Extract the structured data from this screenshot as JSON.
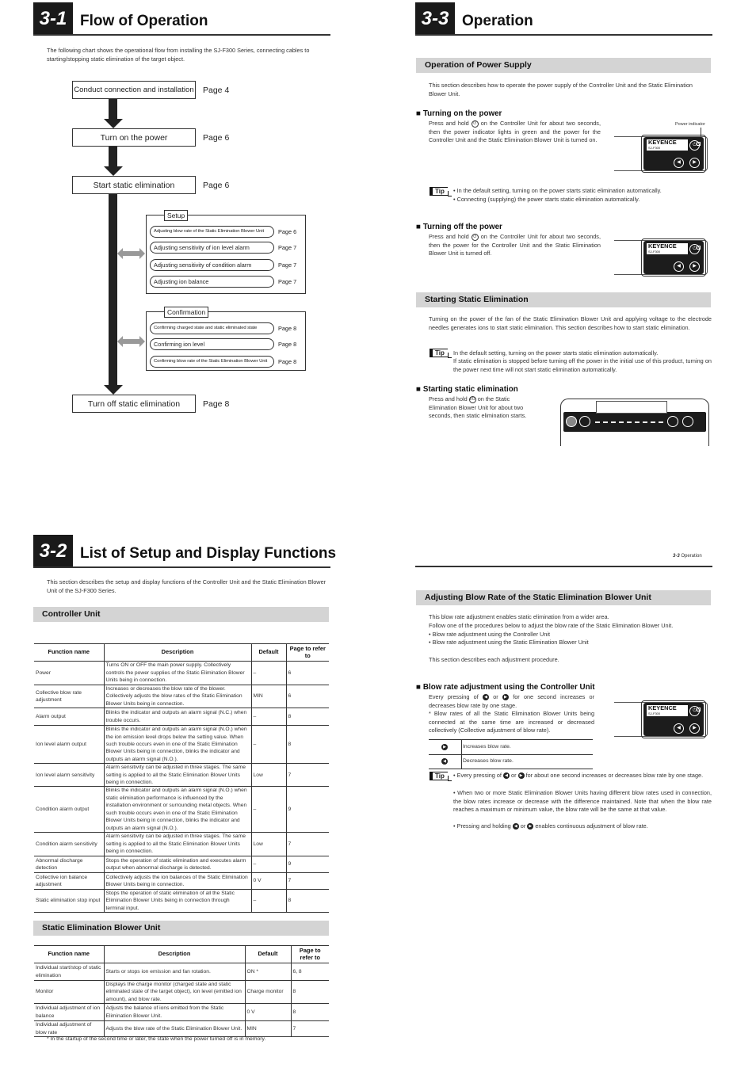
{
  "s31": {
    "num": "3-1",
    "title": "Flow of Operation",
    "intro": "The following chart shows the operational flow from installing the SJ-F300 Series, connecting cables to starting/stopping static elimination of the target object.",
    "steps": [
      {
        "label": "Conduct connection and installation",
        "page": "Page 4"
      },
      {
        "label": "Turn on the power",
        "page": "Page 6"
      },
      {
        "label": "Start static elimination",
        "page": "Page 6"
      },
      {
        "label": "Turn off static elimination",
        "page": "Page 8"
      }
    ],
    "setup": {
      "label": "Setup",
      "items": [
        {
          "label": "Adjusting blow rate of the Static Elimination Blower Unit",
          "page": "Page 6"
        },
        {
          "label": "Adjusting sensitivity of ion level alarm",
          "page": "Page 7"
        },
        {
          "label": "Adjusting sensitivity of condition alarm",
          "page": "Page 7"
        },
        {
          "label": "Adjusting ion balance",
          "page": "Page 7"
        }
      ]
    },
    "confirmation": {
      "label": "Confirmation",
      "items": [
        {
          "label": "Confirming charged state and static eliminated state",
          "page": "Page 8"
        },
        {
          "label": "Confirming ion level",
          "page": "Page 8"
        },
        {
          "label": "Confirming blow rate of the Static Elimination Blower Unit",
          "page": "Page 8"
        }
      ]
    }
  },
  "s32": {
    "num": "3-2",
    "title": "List of Setup and Display Functions",
    "intro": "This section describes the setup and display functions of the Controller Unit and the Static Elimination Blower Unit of the SJ-F300 Series.",
    "headers": [
      "Function name",
      "Description",
      "Default",
      "Page to refer to"
    ],
    "controller": {
      "title": "Controller Unit",
      "rows": [
        [
          "Power",
          "Turns ON or OFF the main power supply. Collectively controls the power supplies of the Static Elimination Blower Units being in connection.",
          "–",
          "6"
        ],
        [
          "Collective blow rate adjustment",
          "Increases or decreases the blow rate of the blower. Collectively adjusts the blow rates of the Static Elimination Blower Units being in connection.",
          "MIN",
          "6"
        ],
        [
          "Alarm output",
          "Blinks the indicator and outputs an alarm signal (N.C.) when trouble occurs.",
          "–",
          "8"
        ],
        [
          "Ion level alarm output",
          "Blinks the indicator and outputs an alarm signal (N.O.) when the ion emission level drops below the setting value. When such trouble occurs even in one of the Static Elimination Blower Units being in connection, blinks the indicator and outputs an alarm signal (N.O.).",
          "–",
          "8"
        ],
        [
          "Ion level alarm sensitivity",
          "Alarm sensitivity can be adjusted in three stages. The same setting is applied to all the Static Elimination Blower Units being in connection.",
          "Low",
          "7"
        ],
        [
          "Condition alarm output",
          "Blinks the indicator and outputs an alarm signal (N.O.) when static elimination performance is influenced by the installation environment or surrounding metal objects. When such trouble occurs even in one of the Static Elimination Blower Units being in connection, blinks the indicator and outputs an alarm signal (N.O.).",
          "–",
          "9"
        ],
        [
          "Condition alarm sensitivity",
          "Alarm sensitivity can be adjusted in three stages. The same setting is applied to all the Static Elimination Blower Units being in connection.",
          "Low",
          "7"
        ],
        [
          "Abnormal discharge detection",
          "Stops the operation of static elimination and executes alarm output when abnormal discharge is detected.",
          "–",
          "9"
        ],
        [
          "Collective ion balance adjustment",
          "Collectively adjusts the ion balances of the Static Elimination Blower Units being in connection.",
          "0 V",
          "7"
        ],
        [
          "Static elimination stop input",
          "Stops the operation of static elimination of all the Static Elimination Blower Units being in connection through terminal input.",
          "–",
          "8"
        ]
      ]
    },
    "blower": {
      "title": "Static Elimination Blower Unit",
      "rows": [
        [
          "Individual start/stop of static elimination",
          "Starts or stops ion emission and fan rotation.",
          "ON *",
          "6, 8"
        ],
        [
          "Monitor",
          "Displays the charge monitor (charged state and static eliminated state of the target object), ion level (emitted ion amount), and blow rate.",
          "Charge monitor",
          "8"
        ],
        [
          "Individual adjustment of ion balance",
          "Adjusts the balance of ions emitted from the Static Elimination Blower Unit.",
          "0 V",
          "8"
        ],
        [
          "Individual adjustment of blow rate",
          "Adjusts the blow rate of the Static Elimination Blower Unit.",
          "MIN",
          "7"
        ]
      ],
      "footnote": "* In the startup of the second time or later, the state when the power turned off is in memory."
    }
  },
  "s33": {
    "num": "3-3",
    "title": "Operation",
    "tip_label": "Tip",
    "device": {
      "logo": "KEYENCE",
      "model": "SJ-F300"
    },
    "power_supply": {
      "title": "Operation of Power Supply",
      "intro": "This section describes how to operate the power supply of the Controller Unit and the Static Elimination Blower Unit.",
      "on_title": "Turning on the power",
      "on_text_a": "Press and hold",
      "on_text_b": "on the Controller Unit for about two seconds, then the power indicator lights in green and the power for the Controller Unit and the Static Elimination Blower Unit is turned on.",
      "power_indicator": "Power indicator",
      "tip1": "• In the default setting, turning on the power starts static elimination automatically.",
      "tip2": "• Connecting (supplying) the power starts static elimination automatically.",
      "off_title": "Turning off the power",
      "off_text_a": "Press and hold",
      "off_text_b": "on the Controller Unit for about two seconds, then the power for the Controller Unit and the Static Elimination Blower Unit is turned off."
    },
    "starting": {
      "title": "Starting Static Elimination",
      "intro": "Turning on the power of the fan of the Static Elimination Blower Unit and applying voltage to the electrode needles generates ions to start static elimination. This section describes how to start static elimination.",
      "tip1": "In the default setting, turning on the power starts static elimination automatically.",
      "tip2": "If static elimination is stopped before turning off the power in the initial use of this product, turning on the power next time will not start static elimination automatically.",
      "sub_title": "Starting static elimination",
      "text_a": "Press and hold",
      "text_b": "on the Static Elimination Blower Unit for about two seconds, then static elimination starts."
    },
    "page_footer": {
      "num": "3-3",
      "label": "Operation"
    },
    "blow": {
      "title": "Adjusting Blow Rate of the Static Elimination Blower Unit",
      "p1": "This blow rate adjustment enables static elimination from a wider area.",
      "p2": "Follow one of the procedures below to adjust the blow rate of the Static Elimination Blower Unit.",
      "b1": "•  Blow rate adjustment using the Controller Unit",
      "b2": "•  Blow rate adjustment using the Static Elimination Blower Unit",
      "p3": "This section describes each adjustment procedure.",
      "sub_title": "Blow rate adjustment using the Controller Unit",
      "text_a": "Every pressing of",
      "text_or": "or",
      "text_b": "for one second increases or decreases blow rate by one stage.",
      "text_c": "* Blow rates of all the Static Elimination Blower Units being connected at the same time are increased or decreased collectively (Collective adjustment of blow rate).",
      "inc": "Increases blow rate.",
      "dec": "Decreases blow rate.",
      "tip1a": "• Every pressing of",
      "tip1b": "for about one second increases or decreases blow rate by one stage.",
      "tip2": "• When two or more Static Elimination Blower Units having different blow rates used in connection, the blow rates increase or decrease with the difference maintained. Note that when the blow rate reaches a maximum or minimum value, the blow rate will be the same at that value.",
      "tip3a": "• Pressing and holding",
      "tip3b": "enables continuous adjustment of blow rate."
    }
  }
}
